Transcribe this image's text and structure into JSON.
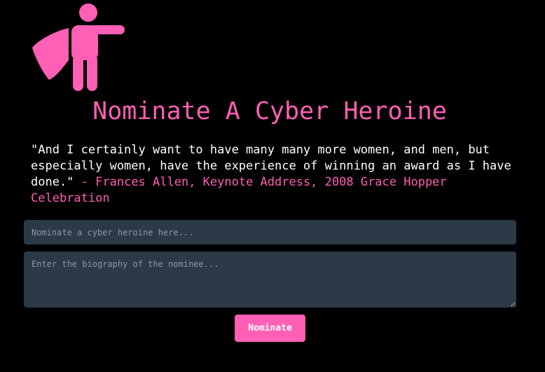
{
  "brand": {
    "accent_color": "#ff5fb4",
    "logo_icon": "caped-hero-pointing-icon"
  },
  "header": {
    "title": "Nominate A Cyber Heroine"
  },
  "quote": {
    "text": "\"And I certainly want to have many many more women, and men, but especially women, have the experience of winning an award as I have done.\"",
    "separator": " - ",
    "attribution": "Frances Allen, Keynote Address, 2008 Grace Hopper Celebration"
  },
  "form": {
    "name_placeholder": "Nominate a cyber heroine here...",
    "name_value": "",
    "bio_placeholder": "Enter the biography of the nominee...",
    "bio_value": "",
    "submit_label": "Nominate"
  }
}
